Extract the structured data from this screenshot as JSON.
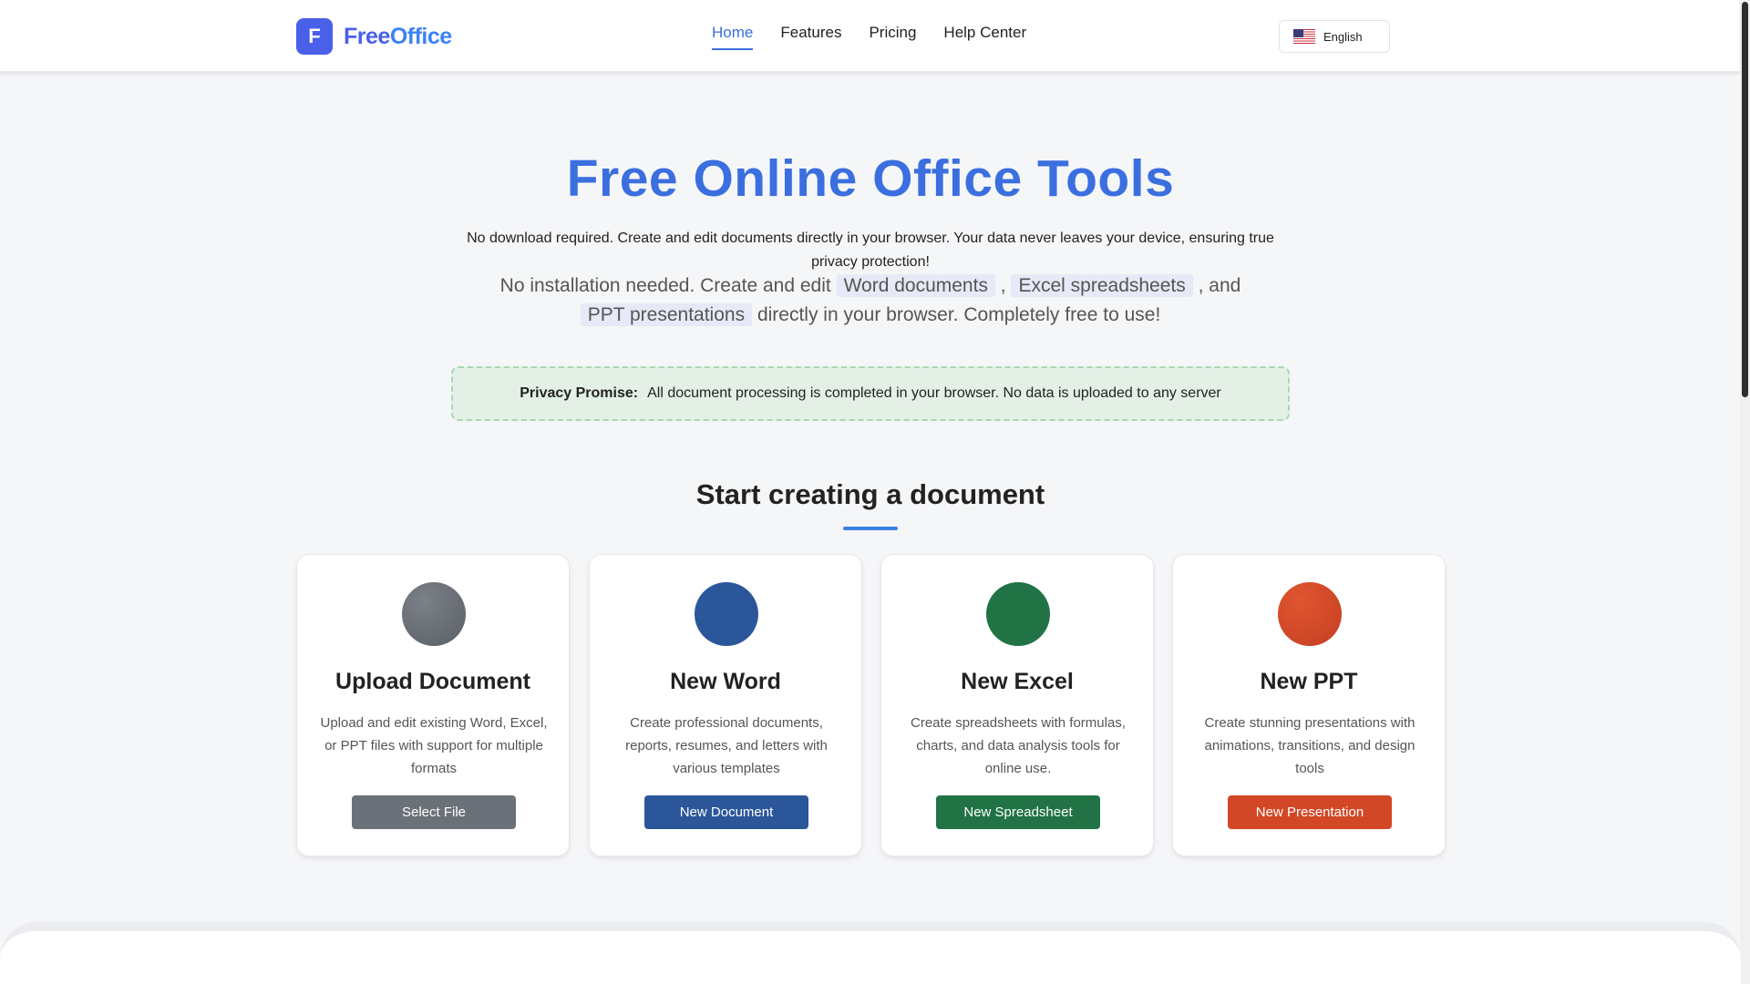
{
  "header": {
    "logo_mark": "F",
    "logo_free": "Free",
    "logo_office": "Office",
    "nav": [
      {
        "label": "Home",
        "active": true
      },
      {
        "label": "Features",
        "active": false
      },
      {
        "label": "Pricing",
        "active": false
      },
      {
        "label": "Help Center",
        "active": false
      }
    ],
    "language": "English",
    "language_flag_icon": "us-flag-icon"
  },
  "hero": {
    "title": "Free Online Office Tools",
    "subtitle_1": "No download required. Create and edit documents directly in your browser. Your data never leaves your device, ensuring true privacy protection!",
    "subtitle_2_prefix": "No installation needed. Create and edit",
    "tag_word": "Word documents",
    "comma": ",",
    "tag_excel": "Excel spreadsheets",
    "and_text": ", and",
    "tag_ppt": "PPT presentations",
    "subtitle_2_suffix": "directly in your browser. Completely free to use!"
  },
  "privacy": {
    "label": "Privacy Promise:",
    "text": "All document processing is completed in your browser. No data is uploaded to any server"
  },
  "section": {
    "title": "Start creating a document"
  },
  "cards": [
    {
      "title": "Upload Document",
      "description": "Upload and edit existing Word, Excel, or PPT files with support for multiple formats",
      "button": "Select File",
      "color": "#6b7178",
      "icon": "upload-icon"
    },
    {
      "title": "New Word",
      "description": "Create professional documents, reports, resumes, and letters with various templates",
      "button": "New Document",
      "color": "#2b579a",
      "icon": "word-icon"
    },
    {
      "title": "New Excel",
      "description": "Create spreadsheets with formulas, charts, and data analysis tools for online use.",
      "button": "New Spreadsheet",
      "color": "#217346",
      "icon": "excel-icon"
    },
    {
      "title": "New PPT",
      "description": "Create stunning presentations with animations, transitions, and design tools",
      "button": "New Presentation",
      "color": "#d24726",
      "icon": "ppt-icon"
    }
  ],
  "colors": {
    "brand": "#4a60e8",
    "accent": "#3b6fe0",
    "privacy_bg": "#e4efe6",
    "privacy_border": "#a8d8b0"
  }
}
